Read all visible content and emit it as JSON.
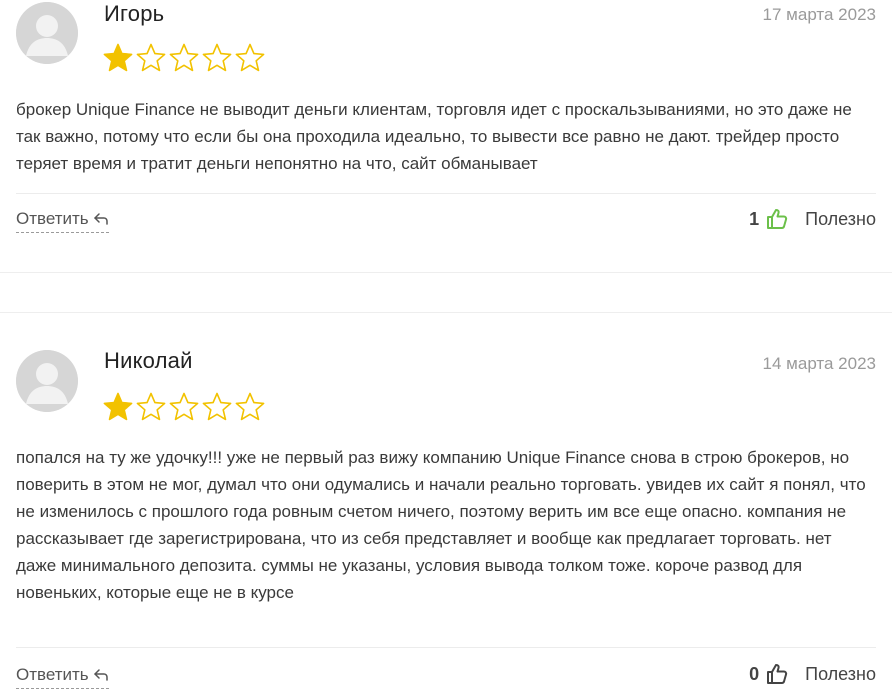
{
  "colors": {
    "star_filled": "#f2c200",
    "star_empty": "#f2c200",
    "thumb_active": "#6cc04a",
    "thumb_inactive": "#444444",
    "date": "#9a9a9a"
  },
  "reviews": [
    {
      "author": "Игорь",
      "date": "17 марта 2023",
      "rating": 1,
      "max_rating": 5,
      "text": "брокер Unique Finance не выводит деньги клиентам, торговля идет с проскальзываниями, но это даже не так важно, потому что если бы она проходила идеально, то вывести все равно не дают. трейдер просто теряет время и тратит деньги непонятно на что, сайт обманывает",
      "reply_label": "Ответить",
      "useful_count": "1",
      "useful_label": "Полезно",
      "thumb_icon": "thumb-up-outline-icon",
      "thumb_active": true
    },
    {
      "author": "Николай",
      "date": "14 марта 2023",
      "rating": 1,
      "max_rating": 5,
      "text": "попался на ту же удочку!!! уже не первый раз вижу компанию Unique Finance снова в строю брокеров, но поверить в этом не мог, думал что они одумались и начали реально торговать. увидев их сайт я понял, что не изменилось с прошлого года ровным счетом ничего, поэтому верить им все еще опасно. компания не рассказывает где зарегистрирована, что из себя представляет и вообще как предлагает торговать. нет даже минимального депозита. суммы не указаны, условия вывода толком тоже. короче развод для новеньких, которые еще не в курсе",
      "reply_label": "Ответить",
      "useful_count": "0",
      "useful_label": "Полезно",
      "thumb_icon": "thumb-up-outline-icon",
      "thumb_active": false
    }
  ]
}
